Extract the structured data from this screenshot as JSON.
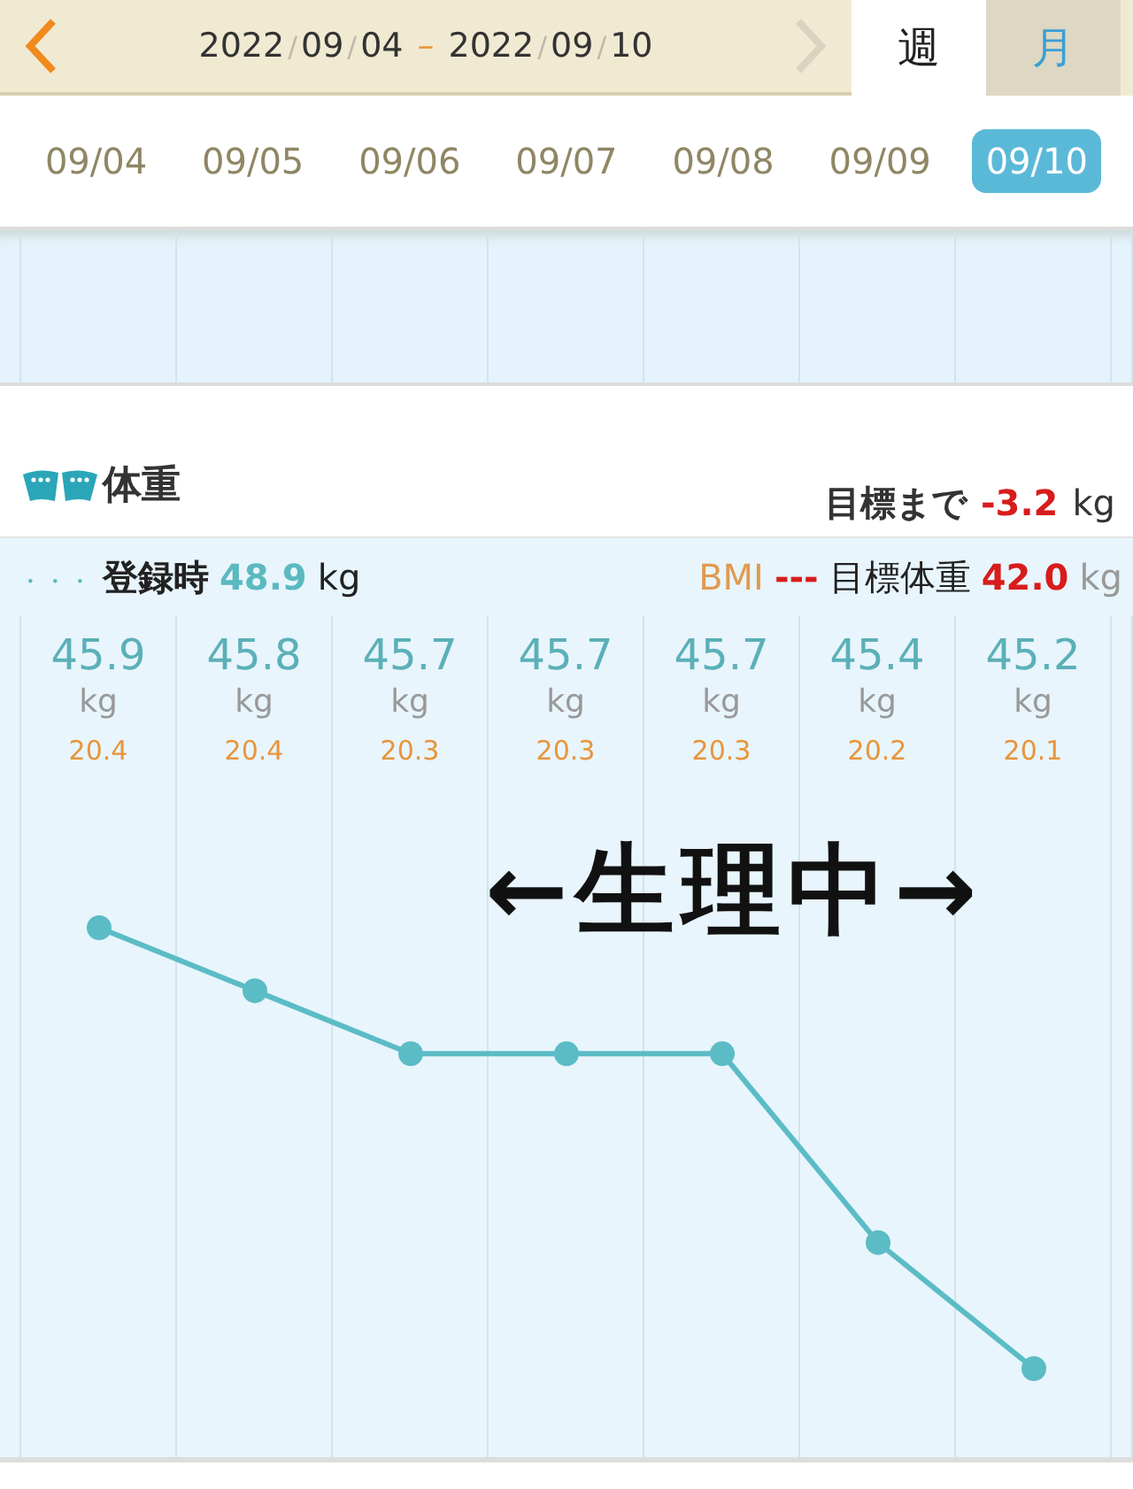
{
  "header": {
    "range_start": [
      "2022",
      "09",
      "04"
    ],
    "date_separator": "/",
    "range_separator": "–",
    "range_end": [
      "2022",
      "09",
      "10"
    ],
    "next_disabled": true,
    "tabs": [
      {
        "label": "週",
        "selected": true
      },
      {
        "label": "月",
        "selected": false
      }
    ]
  },
  "days": [
    {
      "label": "09/04",
      "selected": false
    },
    {
      "label": "09/05",
      "selected": false
    },
    {
      "label": "09/06",
      "selected": false
    },
    {
      "label": "09/07",
      "selected": false
    },
    {
      "label": "09/08",
      "selected": false
    },
    {
      "label": "09/09",
      "selected": false
    },
    {
      "label": "09/10",
      "selected": true
    }
  ],
  "weight": {
    "title": "体重",
    "to_goal_label": "目標まで",
    "to_goal_value": "-3.2",
    "to_goal_unit": "kg",
    "legend_marker": "・・・",
    "registered_label": "登録時",
    "registered_value": "48.9",
    "registered_unit": "kg",
    "bmi_label": "BMI",
    "bmi_marker": "---",
    "goal_label": "目標体重",
    "goal_value": "42.0",
    "goal_unit": "kg"
  },
  "readings": [
    {
      "unit": "kg",
      "bmi": "20.4"
    },
    {
      "unit": "kg",
      "bmi": "20.4"
    },
    {
      "unit": "kg",
      "bmi": "20.3"
    },
    {
      "unit": "kg",
      "bmi": "20.3"
    },
    {
      "unit": "kg",
      "bmi": "20.3"
    },
    {
      "unit": "kg",
      "bmi": "20.2"
    },
    {
      "unit": "kg",
      "bmi": "20.1"
    }
  ],
  "annotation": "←生理中→",
  "chart_data": {
    "type": "line",
    "data_labels": true,
    "series": [
      {
        "color": "#5bbcc6",
        "marker": true,
        "values": [
          45.9,
          45.8,
          45.7,
          45.7,
          45.7,
          45.4,
          45.2
        ]
      }
    ]
  }
}
